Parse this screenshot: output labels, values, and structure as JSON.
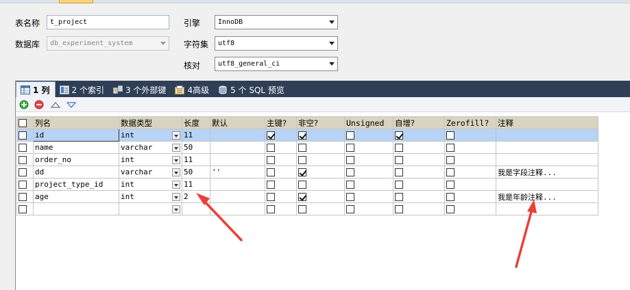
{
  "form": {
    "table_name_label": "表名称",
    "table_name_value": "t_project",
    "database_label": "数据库",
    "database_value": "db_experiment_system",
    "engine_label": "引擎",
    "engine_value": "InnoDB",
    "charset_label": "字符集",
    "charset_value": "utf8",
    "collation_label": "核对",
    "collation_value": "utf8_general_ci"
  },
  "tabs": [
    {
      "label": "1 列",
      "icon": "columns-icon"
    },
    {
      "label": "2 个索引",
      "icon": "index-icon"
    },
    {
      "label": "3 个外部键",
      "icon": "foreign-key-icon"
    },
    {
      "label": "4高级",
      "icon": "advanced-icon"
    },
    {
      "label": "5 个 SQL 预览",
      "icon": "sql-preview-icon"
    }
  ],
  "columns": {
    "headers": [
      "列名",
      "数据类型",
      "长度",
      "默认",
      "主键?",
      "非空?",
      "Unsigned",
      "自增?",
      "Zerofill?",
      "注释"
    ],
    "rows": [
      {
        "name": "id",
        "type": "int",
        "length": "11",
        "default": "",
        "pk": true,
        "notnull": true,
        "unsigned": false,
        "autoinc": true,
        "zerofill": false,
        "comment": ""
      },
      {
        "name": "name",
        "type": "varchar",
        "length": "50",
        "default": "",
        "pk": false,
        "notnull": false,
        "unsigned": false,
        "autoinc": false,
        "zerofill": false,
        "comment": ""
      },
      {
        "name": "order_no",
        "type": "int",
        "length": "11",
        "default": "",
        "pk": false,
        "notnull": false,
        "unsigned": false,
        "autoinc": false,
        "zerofill": false,
        "comment": ""
      },
      {
        "name": "dd",
        "type": "varchar",
        "length": "50",
        "default": "''",
        "pk": false,
        "notnull": true,
        "unsigned": false,
        "autoinc": false,
        "zerofill": false,
        "comment": "我是字段注释..."
      },
      {
        "name": "project_type_id",
        "type": "int",
        "length": "11",
        "default": "",
        "pk": false,
        "notnull": false,
        "unsigned": false,
        "autoinc": false,
        "zerofill": false,
        "comment": ""
      },
      {
        "name": "age",
        "type": "int",
        "length": "2",
        "default": "",
        "pk": false,
        "notnull": true,
        "unsigned": false,
        "autoinc": false,
        "zerofill": false,
        "comment": "我是年龄注释..."
      },
      {
        "name": "",
        "type": "",
        "length": "",
        "default": "",
        "pk": false,
        "notnull": false,
        "unsigned": false,
        "autoinc": false,
        "zerofill": false,
        "comment": ""
      }
    ]
  },
  "colors": {
    "tabbar": "#2f3f56",
    "header": "#d9d3c1",
    "selected_row": "#b7d3f5",
    "annotation_arrow": "#e8403a"
  }
}
